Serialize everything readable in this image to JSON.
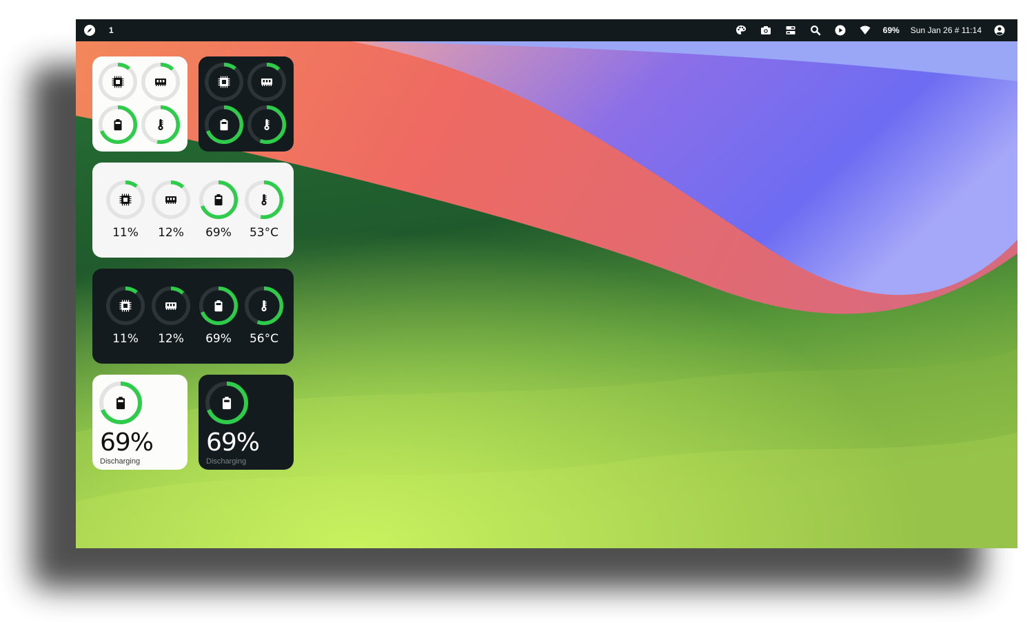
{
  "colors": {
    "accent": "#2ecc4a",
    "track_light": "#e3e3e3",
    "track_dark": "#2c3438",
    "panel_dark": "#141b1f",
    "panel_light": "#f6f6f6"
  },
  "topbar": {
    "launcher_icon": "compass-icon",
    "workspace": "1",
    "icons": [
      "palette-icon",
      "camera-icon",
      "toggles-icon",
      "search-icon",
      "play-icon",
      "wifi-icon"
    ],
    "battery": "69%",
    "datetime": "Sun Jan 26 # 11:14",
    "account_icon": "user-icon"
  },
  "widgets": {
    "small_light": {
      "gauges": [
        {
          "icon": "cpu-icon",
          "value": 0.11
        },
        {
          "icon": "memory-icon",
          "value": 0.12
        },
        {
          "icon": "battery-icon",
          "value": 0.69
        },
        {
          "icon": "thermometer-icon",
          "value": 0.53
        }
      ]
    },
    "small_dark": {
      "gauges": [
        {
          "icon": "cpu-icon",
          "value": 0.11
        },
        {
          "icon": "memory-icon",
          "value": 0.12
        },
        {
          "icon": "battery-icon",
          "value": 0.69
        },
        {
          "icon": "thermometer-icon",
          "value": 0.56
        }
      ]
    },
    "wide_light": {
      "gauges": [
        {
          "icon": "cpu-icon",
          "value": 0.11,
          "label": "11%"
        },
        {
          "icon": "memory-icon",
          "value": 0.12,
          "label": "12%"
        },
        {
          "icon": "battery-icon",
          "value": 0.69,
          "label": "69%"
        },
        {
          "icon": "thermometer-icon",
          "value": 0.53,
          "label": "53°C"
        }
      ]
    },
    "wide_dark": {
      "gauges": [
        {
          "icon": "cpu-icon",
          "value": 0.11,
          "label": "11%"
        },
        {
          "icon": "memory-icon",
          "value": 0.12,
          "label": "12%"
        },
        {
          "icon": "battery-icon",
          "value": 0.69,
          "label": "69%"
        },
        {
          "icon": "thermometer-icon",
          "value": 0.56,
          "label": "56°C"
        }
      ]
    },
    "battery_light": {
      "icon": "battery-icon",
      "value": 0.69,
      "percent": "69%",
      "status": "Discharging"
    },
    "battery_dark": {
      "icon": "battery-icon",
      "value": 0.69,
      "percent": "69%",
      "status": "Discharging"
    }
  }
}
